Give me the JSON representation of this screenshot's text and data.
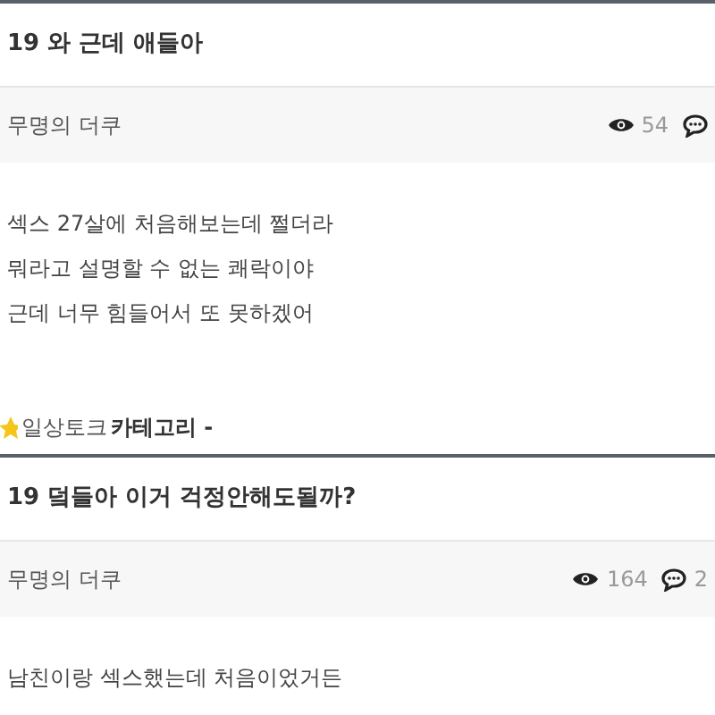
{
  "posts": [
    {
      "title": "19 와 근데 애들아",
      "author": "무명의 더쿠",
      "views": "54",
      "body": [
        "섹스 27살에 처음해보는데 쩔더라",
        "뭐라고 설명할 수 없는 쾌락이야",
        "근데 너무 힘들어서 또 못하겠어"
      ],
      "category": {
        "name": "일상토크",
        "label": "카테고리 -"
      }
    },
    {
      "title": "19 덬들아 이거 걱정안해도될까?",
      "author": "무명의 더쿠",
      "views": "164",
      "comments": "2",
      "body": [
        "남친이랑 섹스했는데 처음이었거든"
      ]
    }
  ]
}
